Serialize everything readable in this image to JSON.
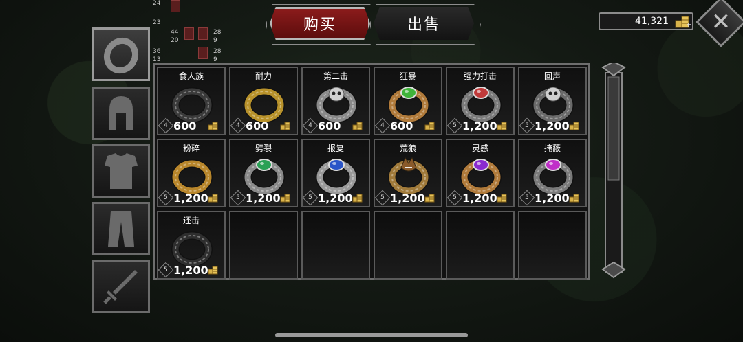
{
  "stats": {
    "rows": [
      {
        "a": "24",
        "b": "",
        "c": ""
      },
      {
        "a": "23",
        "b": "",
        "c": ""
      },
      {
        "a": "44",
        "b": "28"
      },
      {
        "a": "20",
        "b": "9"
      },
      {
        "a": "36",
        "b": "28"
      },
      {
        "a": "13",
        "b": "9"
      }
    ]
  },
  "tabs": {
    "buy_label": "购买",
    "sell_label": "出售",
    "active": "buy"
  },
  "gold": {
    "amount": "41,321"
  },
  "categories": [
    {
      "name": "ring",
      "selected": true
    },
    {
      "name": "helmet",
      "selected": false
    },
    {
      "name": "armor",
      "selected": false
    },
    {
      "name": "pants",
      "selected": false
    },
    {
      "name": "sword",
      "selected": false
    }
  ],
  "items": [
    {
      "name": "食人族",
      "level": "4",
      "price": "600",
      "band": "#3a3a3a",
      "gem": "none"
    },
    {
      "name": "耐力",
      "level": "4",
      "price": "600",
      "band": "#b8922b",
      "gem": "none"
    },
    {
      "name": "第二击",
      "level": "4",
      "price": "600",
      "band": "#8a8a8a",
      "gem": "skull"
    },
    {
      "name": "狂暴",
      "level": "4",
      "price": "600",
      "band": "#b07a3a",
      "gem": "#3fb43a"
    },
    {
      "name": "强力打击",
      "level": "5",
      "price": "1,200",
      "band": "#7a7a7a",
      "gem": "#c03a3a"
    },
    {
      "name": "回声",
      "level": "5",
      "price": "1,200",
      "band": "#6a6a6a",
      "gem": "skull"
    },
    {
      "name": "粉碎",
      "level": "5",
      "price": "1,200",
      "band": "#b8862b",
      "gem": "none"
    },
    {
      "name": "劈裂",
      "level": "5",
      "price": "1,200",
      "band": "#8a8a8a",
      "gem": "#2aa055"
    },
    {
      "name": "报复",
      "level": "5",
      "price": "1,200",
      "band": "#9a9a9a",
      "gem": "#2a55c8"
    },
    {
      "name": "荒狼",
      "level": "5",
      "price": "1,200",
      "band": "#a07a3a",
      "gem": "wolf"
    },
    {
      "name": "灵感",
      "level": "5",
      "price": "1,200",
      "band": "#b07a3a",
      "gem": "#8a2ad0"
    },
    {
      "name": "掩蔽",
      "level": "5",
      "price": "1,200",
      "band": "#7a7a7a",
      "gem": "#c030c8"
    },
    {
      "name": "还击",
      "level": "5",
      "price": "1,200",
      "band": "#2e2e2e",
      "gem": "none"
    }
  ],
  "colors": {
    "accent": "#8e1c1c",
    "frame": "#8b8b8b",
    "gold": "#d8b24a"
  }
}
